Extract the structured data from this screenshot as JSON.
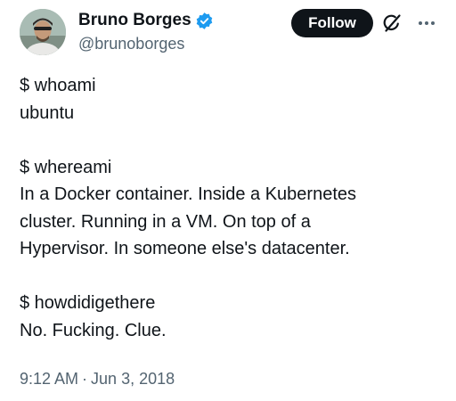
{
  "author": {
    "name": "Bruno Borges",
    "handle": "@brunoborges",
    "verified": true
  },
  "actions": {
    "follow_label": "Follow",
    "grok_icon": "grok-icon",
    "more_icon": "more-options-icon"
  },
  "tweet": {
    "lines": [
      "$ whoami",
      "ubuntu",
      "",
      "$ whereami",
      "In a Docker container. Inside a Kubernetes",
      "cluster. Running in a VM. On top of a",
      "Hypervisor. In someone else's datacenter.",
      "",
      "$ howdidigethere",
      "No. Fucking. Clue."
    ]
  },
  "meta": {
    "time": "9:12 AM",
    "separator": "·",
    "date": "Jun 3, 2018"
  },
  "colors": {
    "text": "#0f1419",
    "secondary": "#536471",
    "verified_badge": "#1d9bf0",
    "follow_bg": "#0f1419"
  }
}
